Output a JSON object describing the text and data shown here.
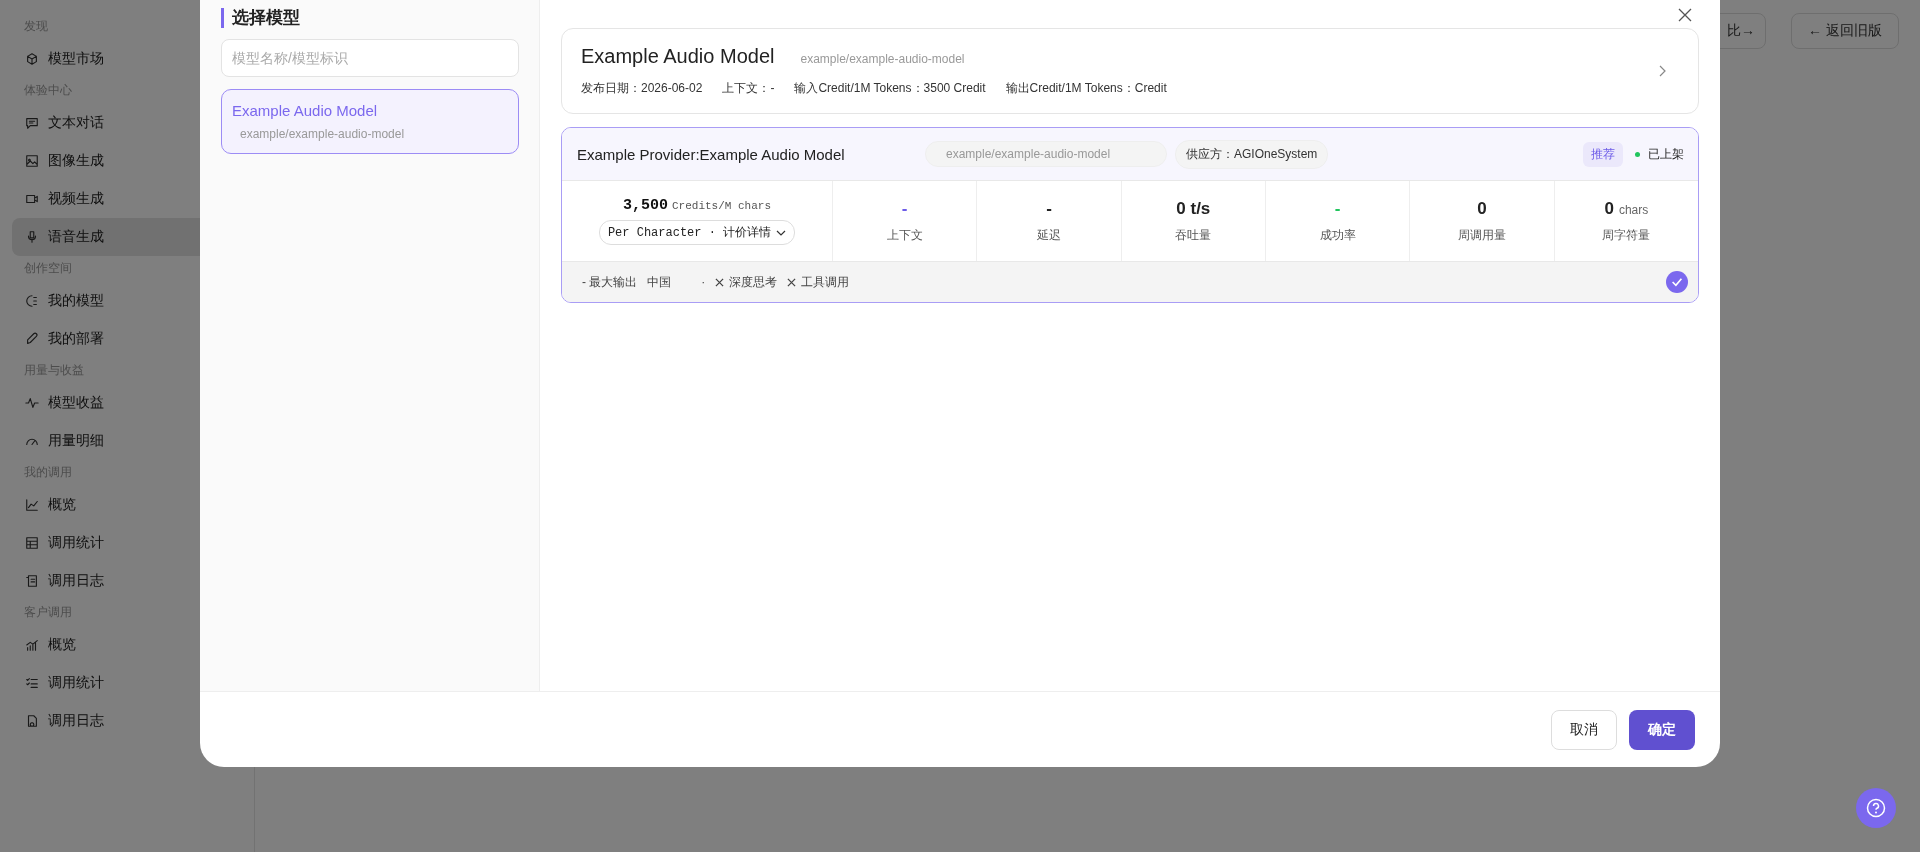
{
  "sidebar": {
    "sections": [
      {
        "title": "发现",
        "items": [
          {
            "label": "模型市场",
            "selected": false
          }
        ]
      },
      {
        "title": "体验中心",
        "items": [
          {
            "label": "文本对话",
            "selected": false
          },
          {
            "label": "图像生成",
            "selected": false
          },
          {
            "label": "视频生成",
            "selected": false
          },
          {
            "label": "语音生成",
            "selected": true
          }
        ]
      },
      {
        "title": "创作空间",
        "items": [
          {
            "label": "我的模型",
            "selected": false
          },
          {
            "label": "我的部署",
            "selected": false
          }
        ]
      },
      {
        "title": "用量与收益",
        "items": [
          {
            "label": "模型收益",
            "selected": false
          },
          {
            "label": "用量明细",
            "selected": false
          }
        ]
      },
      {
        "title": "我的调用",
        "items": [
          {
            "label": "概览",
            "selected": false
          },
          {
            "label": "调用统计",
            "selected": false
          },
          {
            "label": "调用日志",
            "selected": false
          }
        ]
      },
      {
        "title": "客户调用",
        "items": [
          {
            "label": "概览",
            "selected": false
          },
          {
            "label": "调用统计",
            "selected": false
          },
          {
            "label": "调用日志",
            "selected": false
          }
        ]
      }
    ]
  },
  "top_buttons": [
    {
      "label": "比→"
    },
    {
      "label": "← 返回旧版"
    }
  ],
  "modal": {
    "title": "选择模型",
    "search": {
      "placeholder": "模型名称/模型标识"
    },
    "models": [
      {
        "name": "Example Audio Model",
        "id": "example/example-audio-model",
        "selected": true
      }
    ],
    "header": {
      "name": "Example Audio Model",
      "id": "example/example-audio-model",
      "meta": [
        {
          "label": "发布日期：",
          "value": "2026-06-02"
        },
        {
          "label": "上下文：",
          "value": "-"
        },
        {
          "label": "输入Credit/1M Tokens：",
          "value": "3500 Credit"
        },
        {
          "label": "输出Credit/1M Tokens：",
          "value": "Credit"
        }
      ]
    },
    "providers": [
      {
        "name": "Example Provider:Example Audio Model",
        "model_id": "example/example-audio-model",
        "vendor": "供应方：AGIOneSystem",
        "badge": "推荐",
        "status": {
          "label": "已上架",
          "color": "#22c55e"
        },
        "selected": true,
        "price": {
          "amount": "3,500",
          "unit": "Credits/M chars",
          "mode": "Per Character · 计价详情"
        },
        "stats": [
          {
            "value": "-",
            "label": "上下文",
            "color": "#6d5ce8"
          },
          {
            "value": "-",
            "label": "延迟",
            "color": "#222222"
          },
          {
            "value": "0 t/s",
            "label": "吞吐量",
            "color": "#222222"
          },
          {
            "value": "-",
            "label": "成功率",
            "color": "#22c55e"
          },
          {
            "value": "0",
            "label": "周调用量",
            "color": "#222222"
          },
          {
            "value": "0",
            "unit": "chars",
            "label": "周字符量",
            "color": "#222222"
          }
        ],
        "limits": [
          {
            "label": "- 最大输出"
          },
          {
            "label": "中国"
          },
          {
            "label": "·"
          }
        ],
        "capabilities": [
          {
            "label": "深度思考",
            "supported": false
          },
          {
            "label": "工具调用",
            "supported": false
          }
        ]
      }
    ],
    "buttons": [
      {
        "label": "取消",
        "kind": "secondary"
      },
      {
        "label": "确定",
        "kind": "primary"
      }
    ]
  }
}
